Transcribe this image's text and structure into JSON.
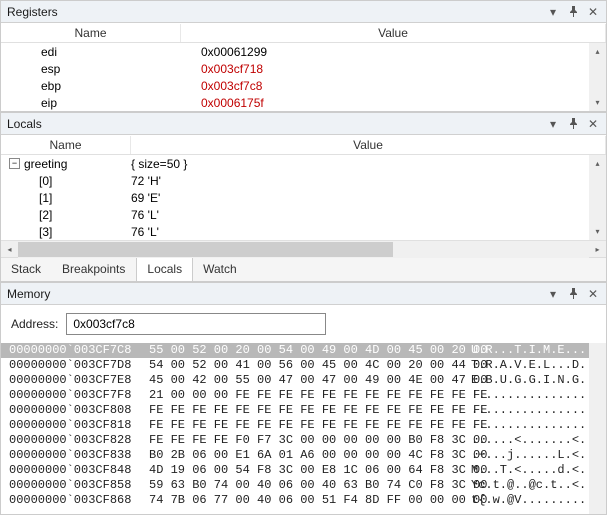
{
  "panels": {
    "registers": {
      "title": "Registers",
      "cols": {
        "name": "Name",
        "value": "Value"
      }
    },
    "locals": {
      "title": "Locals",
      "cols": {
        "name": "Name",
        "value": "Value"
      }
    },
    "memory": {
      "title": "Memory",
      "address_label": "Address:",
      "address_value": "0x003cf7c8"
    }
  },
  "registers": [
    {
      "name": "edi",
      "value": "0x00061299",
      "changed": false
    },
    {
      "name": "esp",
      "value": "0x003cf718",
      "changed": true
    },
    {
      "name": "ebp",
      "value": "0x003cf7c8",
      "changed": true
    },
    {
      "name": "eip",
      "value": "0x0006175f",
      "changed": true
    }
  ],
  "locals": {
    "root": {
      "name": "greeting",
      "summary": "{ size=50 }"
    },
    "children": [
      {
        "idx": "[0]",
        "val": "72 'H'"
      },
      {
        "idx": "[1]",
        "val": "69 'E'"
      },
      {
        "idx": "[2]",
        "val": "76 'L'"
      },
      {
        "idx": "[3]",
        "val": "76 'L'"
      }
    ]
  },
  "tabs": [
    "Stack",
    "Breakpoints",
    "Locals",
    "Watch"
  ],
  "active_tab": "Locals",
  "memory_rows": [
    {
      "addr": "00000000`003CF7C8",
      "hex": "55 00 52 00 20 00 54 00 49 00 4D 00 45 00 20 00",
      "ascii": "U.R...T.I.M.E...",
      "sel": true
    },
    {
      "addr": "00000000`003CF7D8",
      "hex": "54 00 52 00 41 00 56 00 45 00 4C 00 20 00 44 00",
      "ascii": "T.R.A.V.E.L...D."
    },
    {
      "addr": "00000000`003CF7E8",
      "hex": "45 00 42 00 55 00 47 00 47 00 49 00 4E 00 47 00",
      "ascii": "E.B.U.G.G.I.N.G."
    },
    {
      "addr": "00000000`003CF7F8",
      "hex": "21 00 00 00 FE FE FE FE FE FE FE FE FE FE FE FE",
      "ascii": "!..............."
    },
    {
      "addr": "00000000`003CF808",
      "hex": "FE FE FE FE FE FE FE FE FE FE FE FE FE FE FE FE",
      "ascii": "................"
    },
    {
      "addr": "00000000`003CF818",
      "hex": "FE FE FE FE FE FE FE FE FE FE FE FE FE FE FE FE",
      "ascii": "................"
    },
    {
      "addr": "00000000`003CF828",
      "hex": "FE FE FE FE F0 F7 3C 00 00 00 00 00 B0 F8 3C 00",
      "ascii": "......<.......<."
    },
    {
      "addr": "00000000`003CF838",
      "hex": "B0 2B 06 00 E1 6A 01 A6 00 00 00 00 4C F8 3C 00",
      "ascii": ".+...j......L.<."
    },
    {
      "addr": "00000000`003CF848",
      "hex": "4D 19 06 00 54 F8 3C 00 E8 1C 06 00 64 F8 3C 00",
      "ascii": "M...T.<.....d.<."
    },
    {
      "addr": "00000000`003CF858",
      "hex": "59 63 B0 74 00 40 06 00 40 63 B0 74 C0 F8 3C 00",
      "ascii": "Yc.t.@..@c.t..<."
    },
    {
      "addr": "00000000`003CF868",
      "hex": "74 7B 06 77 00 40 06 00 51 F4 8D FF 00 00 00 00",
      "ascii": "t{.w.@V........."
    }
  ]
}
